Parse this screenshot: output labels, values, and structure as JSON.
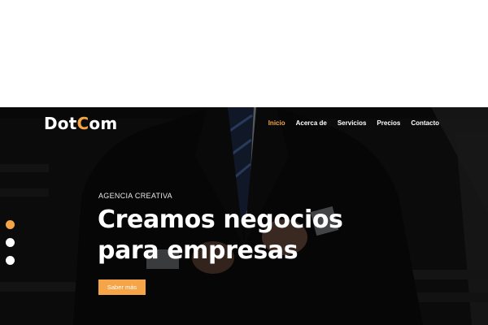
{
  "brand": {
    "part1": "Dot",
    "part2": "C",
    "part3": "om"
  },
  "nav": {
    "items": [
      {
        "label": "Inicio",
        "active": true
      },
      {
        "label": "Acerca de",
        "active": false
      },
      {
        "label": "Servicios",
        "active": false
      },
      {
        "label": "Precios",
        "active": false
      },
      {
        "label": "Contacto",
        "active": false
      }
    ]
  },
  "hero": {
    "kicker": "AGENCIA CREATIVA",
    "headline_line1": "Creamos negocios",
    "headline_line2": "para empresas",
    "cta_label": "Saber más"
  },
  "slider": {
    "count": 3,
    "active_index": 0
  },
  "colors": {
    "accent": "#f5a547",
    "background": "#141414",
    "text": "#ffffff"
  }
}
